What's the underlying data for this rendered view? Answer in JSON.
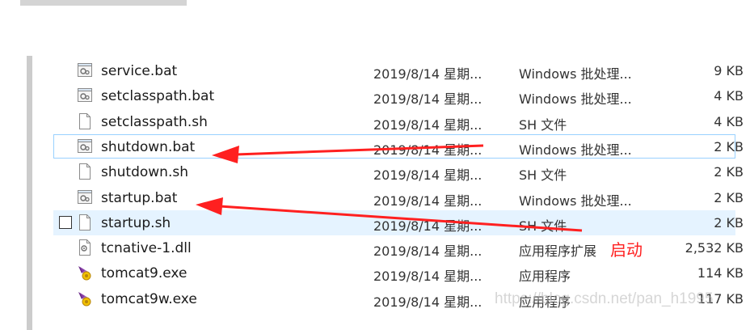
{
  "files": [
    {
      "name": "service.bat",
      "date": "2019/8/14 星期...",
      "type": "Windows 批处理...",
      "size": "9 KB",
      "icon": "batch-file-icon"
    },
    {
      "name": "setclasspath.bat",
      "date": "2019/8/14 星期...",
      "type": "Windows 批处理...",
      "size": "4 KB",
      "icon": "batch-file-icon"
    },
    {
      "name": "setclasspath.sh",
      "date": "2019/8/14 星期...",
      "type": "SH 文件",
      "size": "4 KB",
      "icon": "blank-file-icon"
    },
    {
      "name": "shutdown.bat",
      "date": "2019/8/14 星期...",
      "type": "Windows 批处理...",
      "size": "2 KB",
      "icon": "batch-file-icon",
      "state": "selected"
    },
    {
      "name": "shutdown.sh",
      "date": "2019/8/14 星期...",
      "type": "SH 文件",
      "size": "2 KB",
      "icon": "blank-file-icon"
    },
    {
      "name": "startup.bat",
      "date": "2019/8/14 星期...",
      "type": "Windows 批处理...",
      "size": "2 KB",
      "icon": "batch-file-icon"
    },
    {
      "name": "startup.sh",
      "date": "2019/8/14 星期...",
      "type": "SH 文件",
      "size": "2 KB",
      "icon": "blank-file-icon",
      "state": "hovered"
    },
    {
      "name": "tcnative-1.dll",
      "date": "2019/8/14 星期...",
      "type": "应用程序扩展",
      "size": "2,532 KB",
      "icon": "dll-file-icon"
    },
    {
      "name": "tomcat9.exe",
      "date": "2019/8/14 星期...",
      "type": "应用程序",
      "size": "114 KB",
      "icon": "tomcat-exe-icon"
    },
    {
      "name": "tomcat9w.exe",
      "date": "2019/8/14 星期...",
      "type": "应用程序",
      "size": "117 KB",
      "icon": "tomcat-exe-icon"
    }
  ],
  "annotation": {
    "label": "启动",
    "color": "#ff2020"
  },
  "watermark": "https://blog.csdn.net/pan_h1995",
  "colors": {
    "selection_border": "#99d1ff",
    "hover_bg": "#e5f3ff",
    "arrow": "#ff2020"
  }
}
